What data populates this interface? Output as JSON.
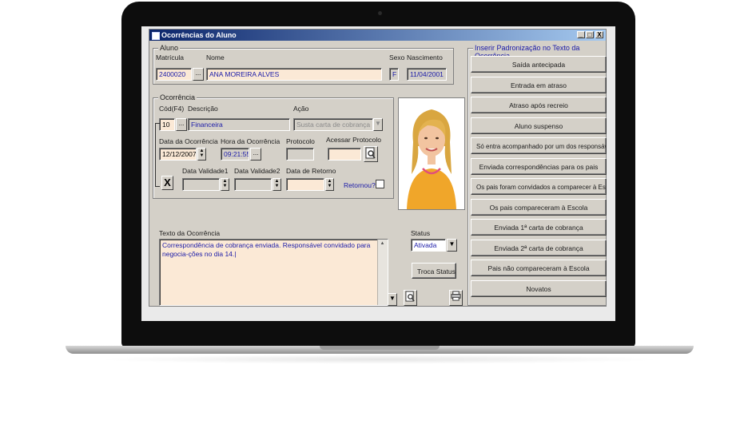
{
  "window": {
    "title": "Ocorrências do Aluno",
    "controls": {
      "minimize": "_",
      "maximize": "□",
      "close": "X"
    }
  },
  "aluno": {
    "group_label": "Aluno",
    "matricula_label": "Matrícula",
    "matricula_value": "2400020",
    "nome_label": "Nome",
    "nome_value": "ANA MOREIRA ALVES",
    "sexo_label": "Sexo",
    "sexo_value": "F",
    "nascimento_label": "Nascimento",
    "nascimento_value": "11/04/2001",
    "lookup_label": "..."
  },
  "ocorrencia": {
    "group_label": "Ocorrência",
    "cod_label": "Cód(F4)",
    "cod_value": "10",
    "descricao_label": "Descrição",
    "descricao_value": "Financeira",
    "acao_label": "Ação",
    "acao_value": "Susta carta de cobrança",
    "data_label": "Data da Ocorrência",
    "data_value": "12/12/2007",
    "hora_label": "Hora da Ocorrência",
    "hora_value": "09:21:55",
    "protocolo_label": "Protocolo",
    "protocolo_value": "",
    "acessar_label": "Acessar Protocolo",
    "validade1_label": "Data Validade1",
    "validade2_label": "Data Validade2",
    "retorno_label": "Data de Retorno",
    "retornou_label": "Retornou?",
    "delete_label": "X"
  },
  "texto": {
    "label": "Texto da Ocorrência",
    "value": "Correspondência de cobrança enviada.  Responsável convidado para negocia-ções no dia 14.|"
  },
  "status": {
    "label": "Status",
    "value": "Ativada",
    "troca_label": "Troca Status"
  },
  "padronizacao": {
    "group_label": "Inserir Padronização no Texto da Ocorrência",
    "items": [
      "Saída antecipada",
      "Entrada em atraso",
      "Atraso após recreio",
      "Aluno suspenso",
      "Só entra acompanhado por um dos responsáveis",
      "Enviada correspondências para os pais",
      "Os pais foram convidados a comparecer à Escola",
      "Os pais compareceram à Escola",
      "Enviada 1ª carta de cobrança",
      "Enviada 2ª carta de cobrança",
      "Pais não compareceram à Escola",
      "Novatos"
    ]
  },
  "colors": {
    "titlebar_start": "#0a246a",
    "titlebar_end": "#a6caf0",
    "window_face": "#d4d0c8",
    "field_highlight": "#fbe9d6",
    "field_text": "#1a1aa8"
  }
}
